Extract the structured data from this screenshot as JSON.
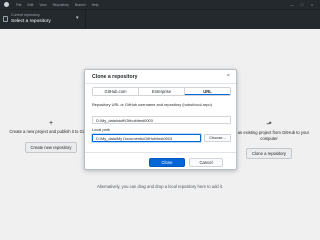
{
  "titlebar": {
    "menu": [
      "File",
      "Edit",
      "View",
      "Repository",
      "Branch",
      "Help"
    ],
    "controls": [
      "—",
      "□",
      "×"
    ]
  },
  "repository_selector": {
    "kicker": "Current repository",
    "title": "Select a repository",
    "caret": "▾"
  },
  "cards": {
    "left": {
      "icon": "+",
      "text": "Create a new project and publish it to GitHub",
      "button": "Create new repository"
    },
    "right": {
      "icon": "⬏",
      "text": "Add an existing project from GitHub to your computer",
      "button": "Clone a repository"
    }
  },
  "drag_drop_hint": "Alternatively, you can drag and drop a local repository here to add it.",
  "dialog": {
    "title": "Clone a repository",
    "close": "×",
    "tabs": [
      "GitHub.com",
      "Enterprise",
      "URL"
    ],
    "active_tab": "URL",
    "url_label": "Repository URL or GitHub username and repository (hubot/cool-repo)",
    "url_value": "D:\\My_data\\stuff\\Github\\test0003",
    "path_label": "Local path",
    "path_value": "D:\\My_data\\My Documents\\GitHub\\test0003",
    "choose_button": "Choose...",
    "clone_button": "Clone",
    "cancel_button": "Cancel"
  },
  "colors": {
    "header_bg": "#24292e",
    "accent": "#0366d6"
  }
}
